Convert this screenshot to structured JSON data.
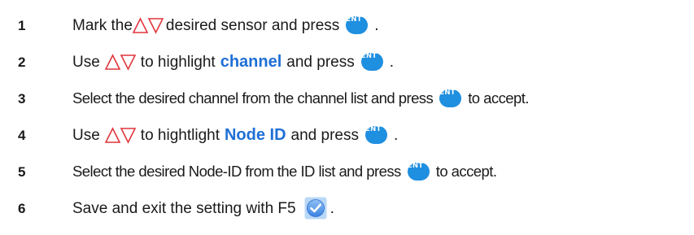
{
  "steps": [
    {
      "number": "1",
      "segments": [
        "Mark the",
        "desired sensor and press",
        "."
      ]
    },
    {
      "number": "2",
      "segments": [
        "Use",
        "to highlight",
        "channel",
        "and press",
        "."
      ]
    },
    {
      "number": "3",
      "segments": [
        "Select the desired channel from the channel list and press",
        "to accept."
      ]
    },
    {
      "number": "4",
      "segments": [
        "Use",
        "to hightlight",
        "Node ID",
        "and press",
        "."
      ]
    },
    {
      "number": "5",
      "segments": [
        "Select the desired Node-ID from the ID list and press",
        "to accept."
      ]
    },
    {
      "number": "6",
      "segments": [
        "Save and exit the setting with F5",
        "."
      ]
    }
  ],
  "ent_button_label": "ENT",
  "icons": {
    "up_down": "up-down-arrows-icon",
    "enter": "ent-button-icon",
    "save": "check-save-icon"
  },
  "colors": {
    "keyword": "#1f6fd6",
    "ent_button": "#1f8fe0",
    "arrow_outline": "#e0353c",
    "save_icon": "#2f7fe0"
  }
}
